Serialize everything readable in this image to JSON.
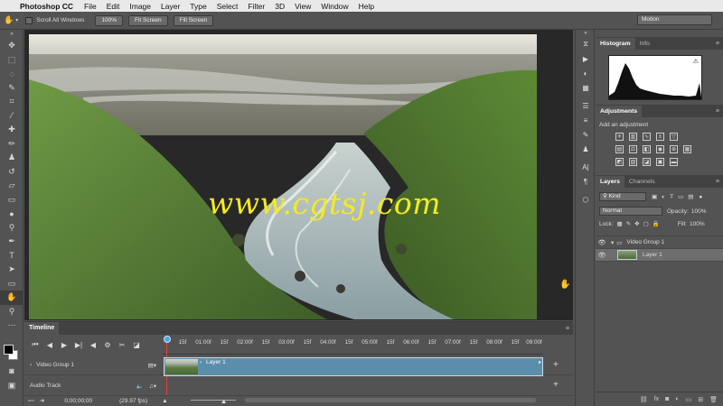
{
  "menubar": {
    "app_name": "Photoshop CC",
    "items": [
      "File",
      "Edit",
      "Image",
      "Layer",
      "Type",
      "Select",
      "Filter",
      "3D",
      "View",
      "Window",
      "Help"
    ]
  },
  "options": {
    "scroll_all_label": "Scroll All Windows",
    "zoom_button": "100%",
    "fit_screen": "Fit Screen",
    "fill_screen": "Fill Screen",
    "workspace": "Motion"
  },
  "canvas": {
    "watermark": "www.cgtsj.com"
  },
  "histogram": {
    "tabs": [
      "Histogram",
      "Info"
    ]
  },
  "adjustments": {
    "tab": "Adjustments",
    "title": "Add an adjustment"
  },
  "layers": {
    "tabs": [
      "Layers",
      "Channels"
    ],
    "filter": "Kind",
    "blend_mode": "Normal",
    "opacity_label": "Opacity:",
    "opacity": "100%",
    "lock_label": "Lock:",
    "fill_label": "Fill:",
    "fill": "100%",
    "group_name": "Video Group 1",
    "layer_name": "Layer 1"
  },
  "timeline": {
    "title": "Timeline",
    "ticks": [
      "15f",
      "01:00f",
      "15f",
      "02:00f",
      "15f",
      "03:00f",
      "15f",
      "04:00f",
      "15f",
      "05:00f",
      "15f",
      "06:00f",
      "15f",
      "07:00f",
      "15f",
      "08:00f",
      "15f",
      "09:00f"
    ],
    "track1": "Video Group 1",
    "track2": "Audio Track",
    "clip_name": "Layer 1",
    "timecode": "0;00;00;00",
    "fps": "(29.97 fps)"
  },
  "colors": {
    "accent": "#5b8eaa",
    "watermark": "#f5ea1e",
    "playhead": "#e04040"
  }
}
